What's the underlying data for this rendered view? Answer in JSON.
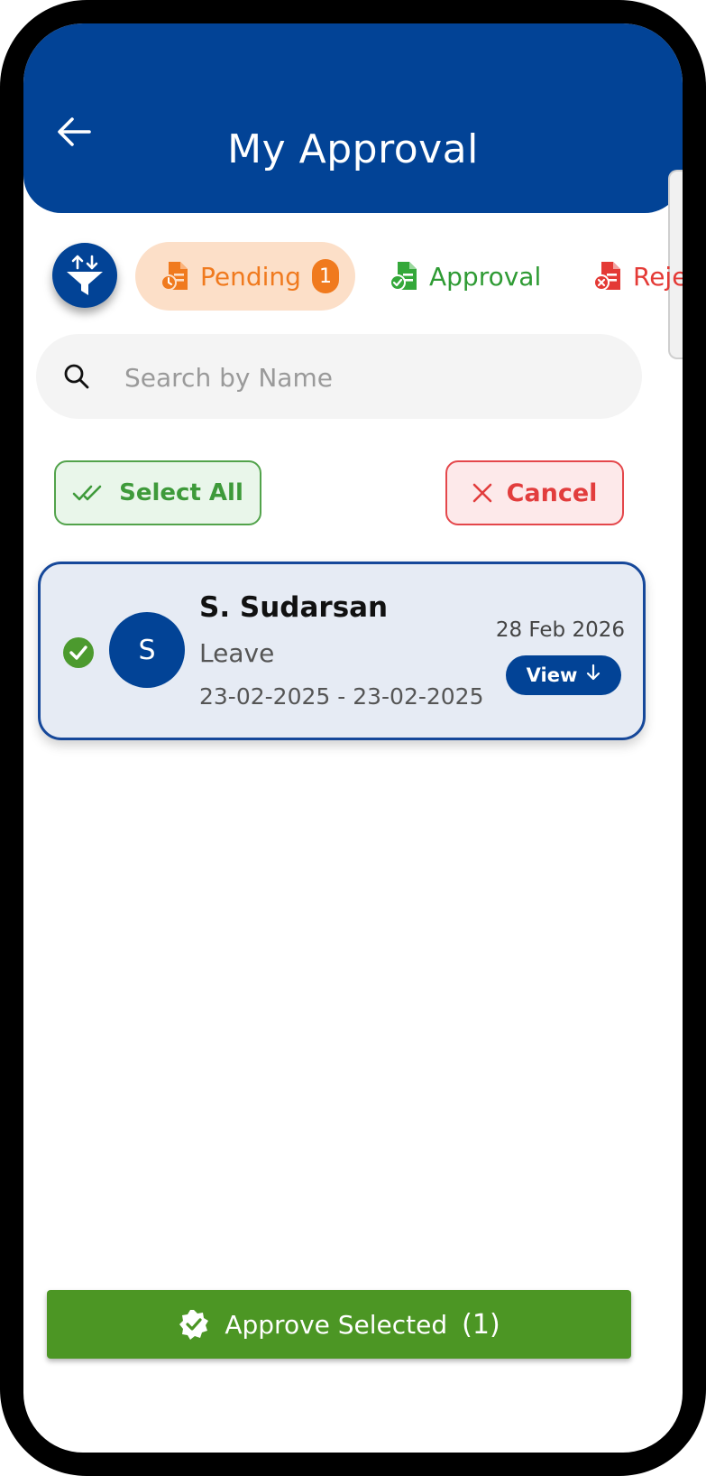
{
  "header": {
    "title": "My Approval"
  },
  "tabs": [
    {
      "label": "Pending",
      "badge": "1",
      "color": "#f07a1e"
    },
    {
      "label": "Approval",
      "color": "#2f9b34"
    },
    {
      "label": "Rejected",
      "color": "#e43a36"
    }
  ],
  "search": {
    "placeholder": "Search by Name",
    "value": ""
  },
  "actions": {
    "select_all": "Select All",
    "cancel": "Cancel"
  },
  "requests": [
    {
      "initial": "S",
      "name": "S. Sudarsan",
      "type": "Leave",
      "range": "23-02-2025 - 23-02-2025",
      "date": "28 Feb 2026",
      "view_label": "View",
      "selected": true
    }
  ],
  "footer": {
    "approve_label": "Approve Selected",
    "count": "(1)"
  },
  "colors": {
    "primary": "#024396",
    "success": "#4c9624",
    "pending_bg": "#fcdfc8"
  }
}
